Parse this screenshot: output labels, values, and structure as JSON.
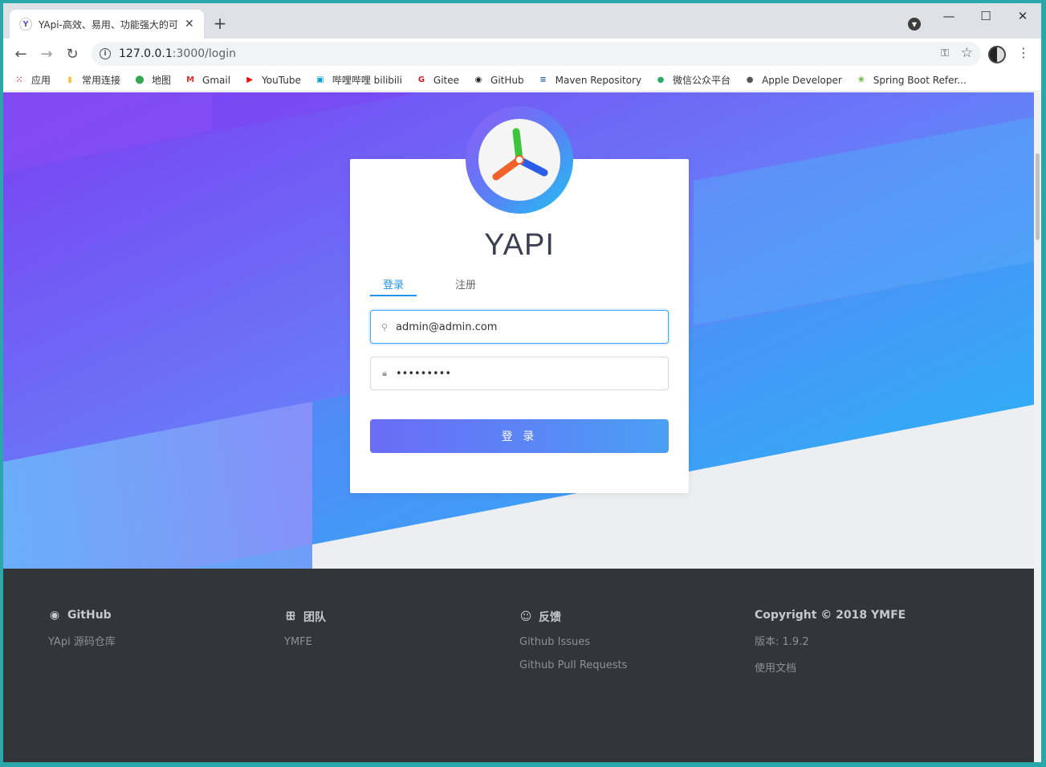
{
  "browser": {
    "tab_title": "YApi-高效、易用、功能强大的可",
    "url_host": "127.0.0.1",
    "url_rest": ":3000/login",
    "bookmarks": [
      {
        "label": "应用",
        "icon": "apps-grid-icon",
        "color": "#e8453c"
      },
      {
        "label": "常用连接",
        "icon": "folder-icon",
        "color": "#f6c343"
      },
      {
        "label": "地图",
        "icon": "maps-pin-icon",
        "color": "#34a853"
      },
      {
        "label": "Gmail",
        "icon": "gmail-icon",
        "color": "#d93025"
      },
      {
        "label": "YouTube",
        "icon": "youtube-icon",
        "color": "#ff0000"
      },
      {
        "label": "哔哩哔哩 bilibili",
        "icon": "bilibili-icon",
        "color": "#00a1d6"
      },
      {
        "label": "Gitee",
        "icon": "gitee-icon",
        "color": "#c71d23"
      },
      {
        "label": "GitHub",
        "icon": "github-icon",
        "color": "#222222"
      },
      {
        "label": "Maven Repository",
        "icon": "maven-icon",
        "color": "#2d5a9a"
      },
      {
        "label": "微信公众平台",
        "icon": "wechat-icon",
        "color": "#2aae67"
      },
      {
        "label": "Apple Developer",
        "icon": "apple-icon",
        "color": "#555555"
      },
      {
        "label": "Spring Boot Refer...",
        "icon": "spring-icon",
        "color": "#6db33f"
      }
    ]
  },
  "login": {
    "title": "YAPI",
    "tab_login": "登录",
    "tab_register": "注册",
    "email_value": "admin@admin.com",
    "password_value": "•••••••••",
    "submit_label": "登 录"
  },
  "footer": {
    "columns": [
      {
        "title": "GitHub",
        "icon": "github-icon",
        "links": [
          "YApi 源码仓库"
        ]
      },
      {
        "title": "团队",
        "icon": "team-icon",
        "links": [
          "YMFE"
        ]
      },
      {
        "title": "反馈",
        "icon": "feedback-icon",
        "links": [
          "Github Issues",
          "Github Pull Requests"
        ]
      },
      {
        "title": "Copyright © 2018 YMFE",
        "icon": "",
        "links": [
          "版本: 1.9.2",
          "使用文档"
        ]
      }
    ]
  },
  "colors": {
    "accent": "#2395f1",
    "footer_bg": "#32363a"
  }
}
